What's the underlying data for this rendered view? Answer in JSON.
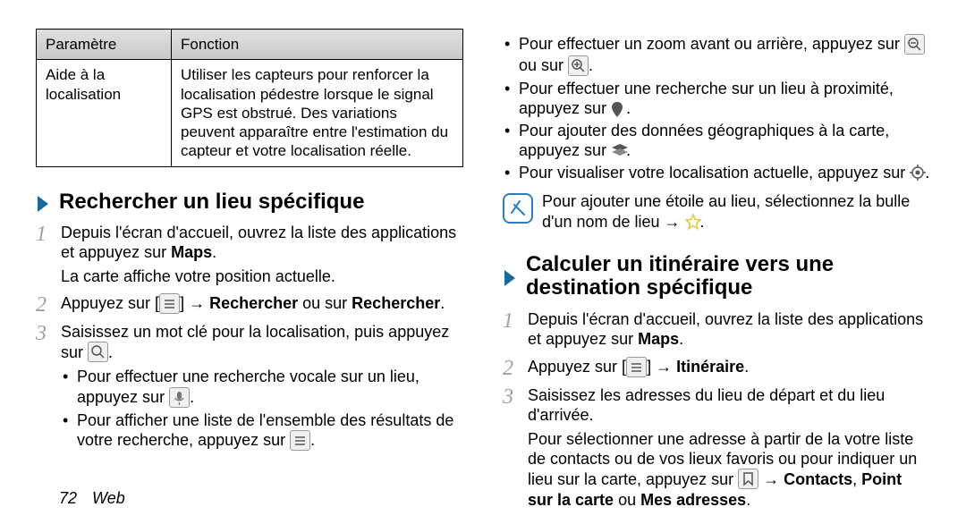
{
  "table": {
    "headers": [
      "Paramètre",
      "Fonction"
    ],
    "row": {
      "param": "Aide à la localisation",
      "fonction": "Utiliser les capteurs pour renforcer la localisation pédestre lorsque le signal GPS est obstrué. Des variations peuvent apparaître entre l'estimation du capteur et votre localisation réelle."
    }
  },
  "left": {
    "heading": "Rechercher un lieu spécifique",
    "step1_a": "Depuis l'écran d'accueil, ouvrez la liste des applications et appuyez sur ",
    "step1_bold": "Maps",
    "step1_end": ".",
    "step1_sub": "La carte affiche votre position actuelle.",
    "step2_a": "Appuyez sur [",
    "step2_b": "] → ",
    "step2_bold": "Rechercher",
    "step2_c": " ou sur ",
    "step2_bold2": "Rechercher",
    "step2_end": ".",
    "step3": "Saisissez un mot clé pour la localisation, puis appuyez sur ",
    "step3_end": ".",
    "bullet1_a": "Pour effectuer une recherche vocale sur un lieu, appuyez sur ",
    "bullet1_end": ".",
    "bullet2_a": "Pour afficher une liste de l'ensemble des résultats de votre recherche, appuyez sur ",
    "bullet2_end": "."
  },
  "right": {
    "bullets": [
      {
        "a": "Pour effectuer un zoom avant ou arrière, appuyez sur ",
        "mid": " ou sur ",
        "end": "."
      },
      {
        "a": "Pour effectuer une recherche sur un lieu à proximité, appuyez sur ",
        "end": "."
      },
      {
        "a": "Pour ajouter des données géographiques à la carte, appuyez sur ",
        "end": "."
      },
      {
        "a": "Pour visualiser votre localisation actuelle, appuyez sur ",
        "end": "."
      }
    ],
    "note_a": "Pour ajouter une étoile au lieu, sélectionnez la bulle d'un nom de lieu → ",
    "note_end": ".",
    "heading": "Calculer un itinéraire vers une destination spécifique",
    "step1_a": "Depuis l'écran d'accueil, ouvrez la liste des applications et appuyez sur ",
    "step1_bold": "Maps",
    "step1_end": ".",
    "step2_a": "Appuyez sur [",
    "step2_b": "] → ",
    "step2_bold": "Itinéraire",
    "step2_end": ".",
    "step3": "Saisissez les adresses du lieu de départ et du lieu d'arrivée.",
    "step3_sub_a": "Pour sélectionner une adresse à partir de la votre liste de contacts ou de vos lieux favoris ou pour indiquer un lieu sur la carte, appuyez sur ",
    "step3_sub_b": " → ",
    "step3_sub_bold1": "Contacts",
    "step3_sub_c": ", ",
    "step3_sub_bold2": "Point sur la carte",
    "step3_sub_d": " ou ",
    "step3_sub_bold3": "Mes adresses",
    "step3_sub_end": "."
  },
  "footer": {
    "page": "72",
    "section": "Web"
  }
}
